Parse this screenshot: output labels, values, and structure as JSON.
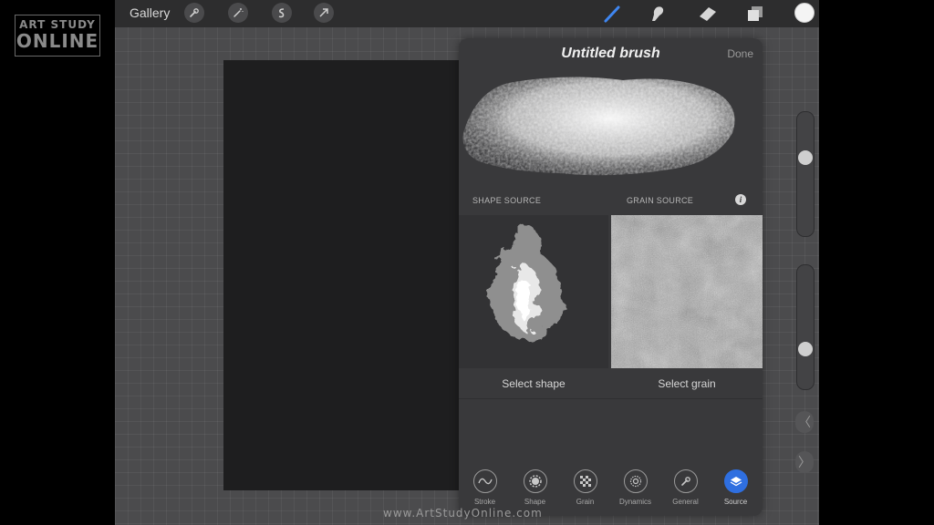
{
  "watermark": {
    "line1": "ART STUDY",
    "line2": "ONLINE"
  },
  "topbar": {
    "gallery_label": "Gallery",
    "left_icons": [
      "wrench-icon",
      "magic-wand-icon",
      "selection-icon",
      "transform-arrow-icon"
    ],
    "right_icons": [
      "brush-icon",
      "smudge-icon",
      "eraser-icon",
      "layers-icon"
    ],
    "active_tool": "brush-icon",
    "color_swatch": "#f4f4f4",
    "accent": "#2f6fe0"
  },
  "brush_panel": {
    "title": "Untitled brush",
    "done_label": "Done",
    "shape_source_label": "SHAPE SOURCE",
    "grain_source_label": "GRAIN SOURCE",
    "info_label": "i",
    "select_shape_label": "Select shape",
    "select_grain_label": "Select grain",
    "tabs": [
      {
        "label": "Stroke",
        "icon": "stroke-wave-icon",
        "active": false
      },
      {
        "label": "Shape",
        "icon": "shape-gear-icon",
        "active": false
      },
      {
        "label": "Grain",
        "icon": "grain-checker-icon",
        "active": false
      },
      {
        "label": "Dynamics",
        "icon": "dynamics-spiral-icon",
        "active": false
      },
      {
        "label": "General",
        "icon": "general-wrench-icon",
        "active": false
      },
      {
        "label": "Source",
        "icon": "source-layers-icon",
        "active": true
      }
    ]
  },
  "sidebar": {
    "brush_size_level": 0.65,
    "opacity_level": 0.3,
    "undo_icon": "chevron-left-icon",
    "redo_icon": "chevron-right-icon",
    "undo_glyph": "〈",
    "redo_glyph": "〉"
  },
  "footer_url": "www.ArtStudyOnline.com"
}
